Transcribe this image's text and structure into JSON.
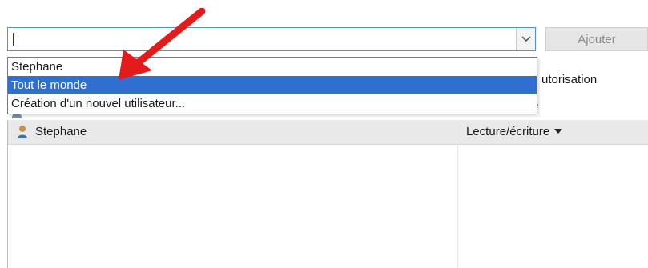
{
  "combo": {
    "value": ""
  },
  "add_button": {
    "label": "Ajouter"
  },
  "dropdown": {
    "options": [
      "Stephane",
      "Tout le monde",
      "Création d'un nouvel utilisateur..."
    ],
    "selected_index": 1
  },
  "permissions": {
    "header": "utorisation",
    "rows": [
      {
        "name": "Stephane",
        "level": "Lecture/écriture"
      }
    ]
  },
  "colors": {
    "selection": "#2f6fd0",
    "arrow": "#e31b1b",
    "focus_border": "#5a8fd6"
  }
}
